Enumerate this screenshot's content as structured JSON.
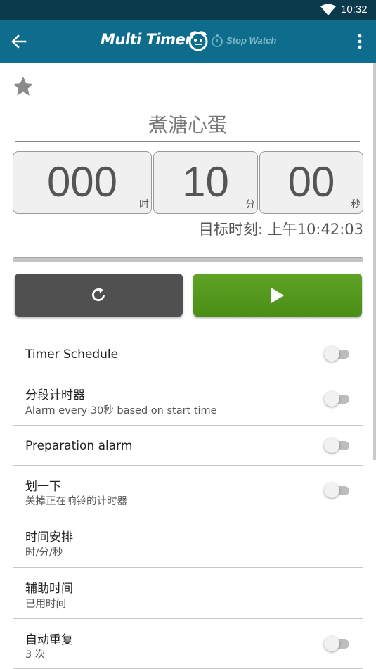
{
  "status_bar": {
    "time": "10:32",
    "icon": "wifi-icon"
  },
  "app_bar": {
    "title": "Multi Timer",
    "stopwatch_label": "Stop Watch",
    "back_icon": "arrow-left-icon",
    "menu_icon": "more-vert-icon",
    "color": "#0e6c8c"
  },
  "timer": {
    "name": "煮溏心蛋",
    "hours": "000",
    "hours_unit": "时",
    "minutes": "10",
    "minutes_unit": "分",
    "seconds": "00",
    "seconds_unit": "秒",
    "target_time": "目标时刻: 上午10:42:03",
    "favorite_icon": "star-icon",
    "progress": 0
  },
  "buttons": {
    "reset_icon": "refresh-icon",
    "start_icon": "play-icon",
    "start_color": "#52991d"
  },
  "settings": [
    {
      "title": "Timer Schedule",
      "subtitle": "",
      "toggle": false,
      "has_toggle": true
    },
    {
      "title": "分段计时器",
      "subtitle": "Alarm every 30秒 based on start time",
      "toggle": false,
      "has_toggle": true
    },
    {
      "title": "Preparation alarm",
      "subtitle": "",
      "toggle": false,
      "has_toggle": true
    },
    {
      "title": "划一下",
      "subtitle": "关掉正在响铃的计时器",
      "toggle": false,
      "has_toggle": true
    },
    {
      "title": "时间安排",
      "subtitle": "时/分/秒",
      "has_toggle": false
    },
    {
      "title": "辅助时间",
      "subtitle": "已用时间",
      "has_toggle": false
    },
    {
      "title": "自动重复",
      "subtitle": "3 次",
      "toggle": false,
      "has_toggle": true
    }
  ]
}
